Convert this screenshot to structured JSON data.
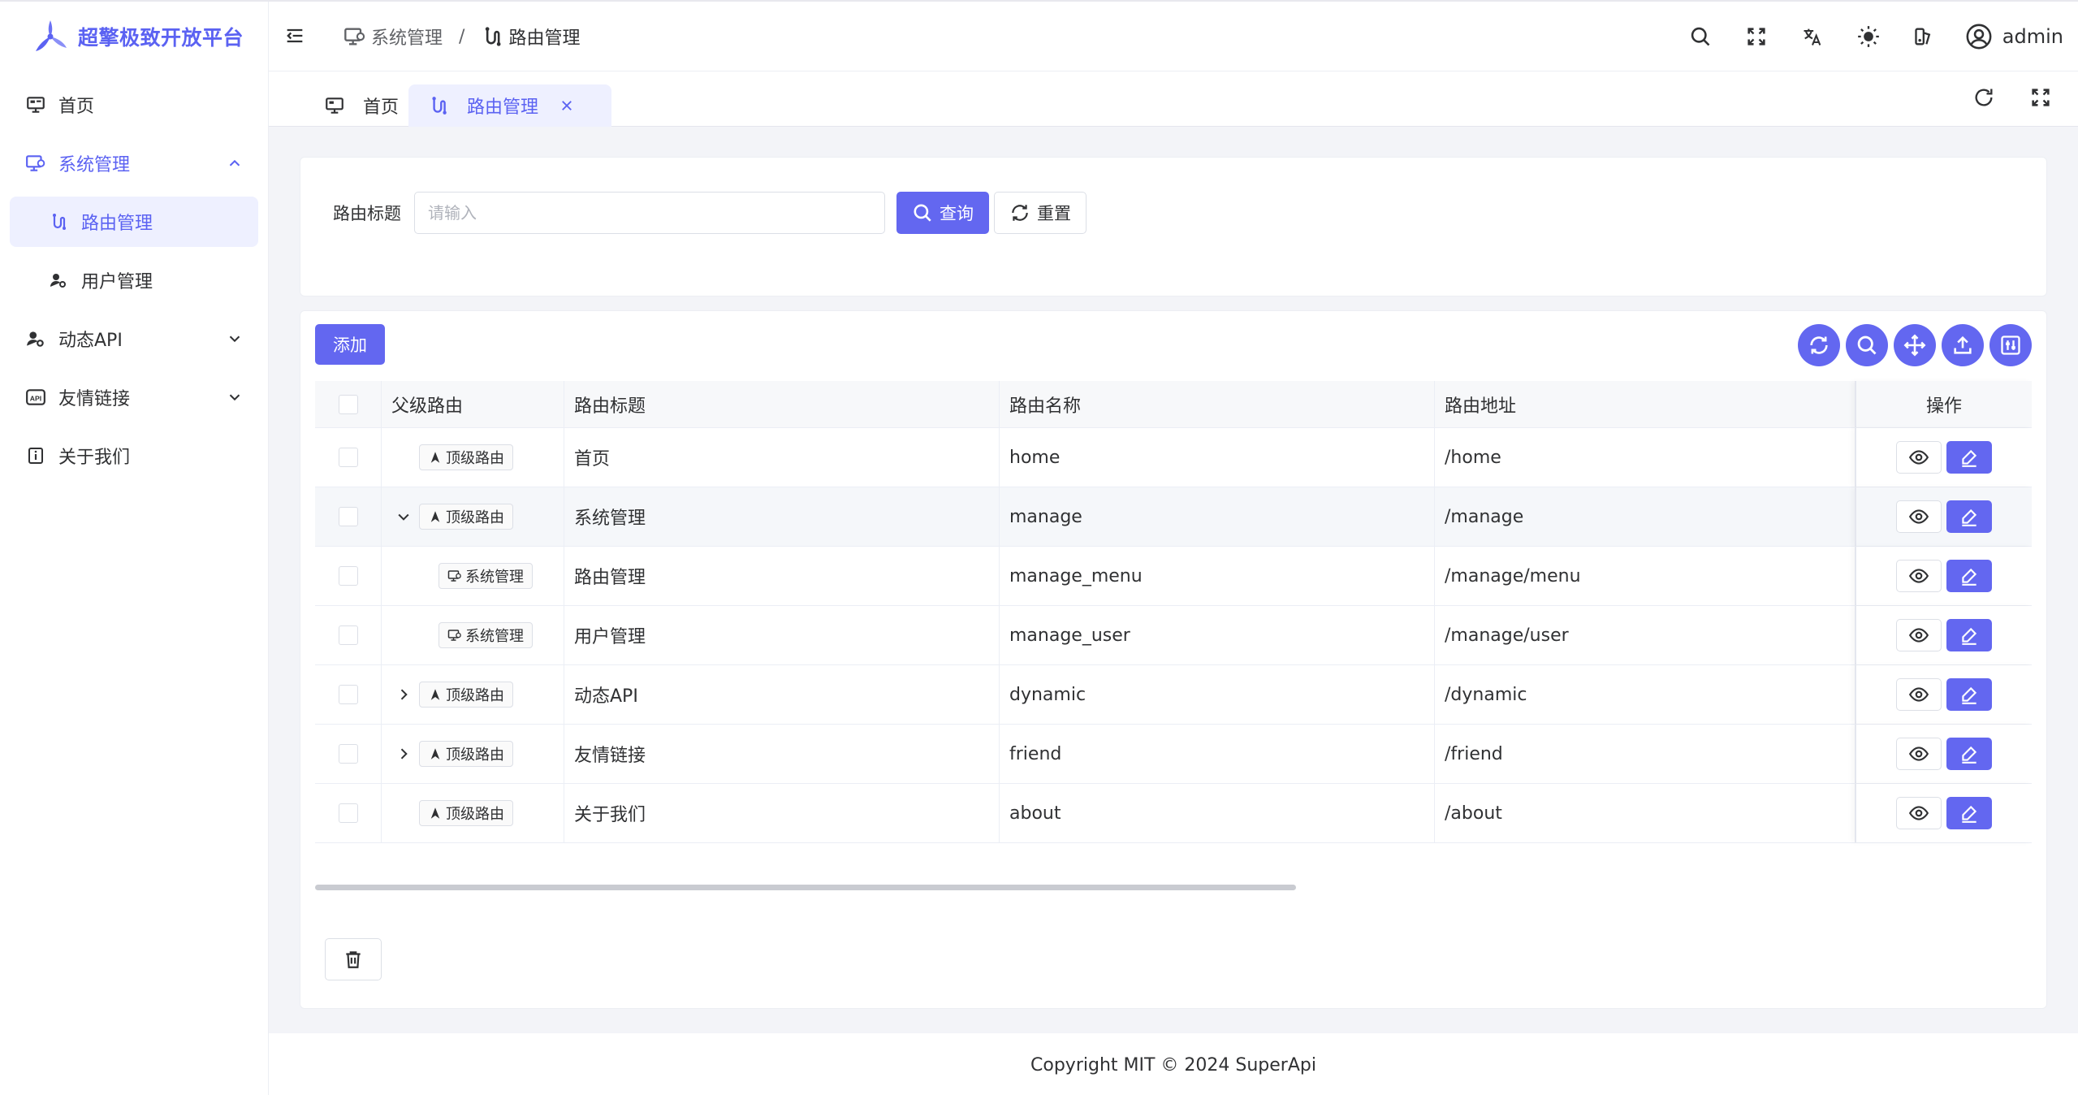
{
  "app": {
    "brand": "超擎极致开放平台",
    "accent": "#6367f0"
  },
  "sidebar": {
    "items": [
      {
        "label": "首页",
        "icon": "monitor-icon"
      },
      {
        "label": "系统管理",
        "icon": "system-monitor-icon",
        "open": true
      },
      {
        "label": "路由管理",
        "icon": "route-icon",
        "active": true
      },
      {
        "label": "用户管理",
        "icon": "user-gear-icon"
      },
      {
        "label": "动态API",
        "icon": "user-gear-icon"
      },
      {
        "label": "友情链接",
        "icon": "api-icon"
      },
      {
        "label": "关于我们",
        "icon": "info-icon"
      }
    ]
  },
  "header": {
    "breadcrumb": [
      "系统管理",
      "路由管理"
    ],
    "username": "admin"
  },
  "tabs": [
    "首页",
    "路由管理"
  ],
  "search": {
    "label": "路由标题",
    "placeholder": "请输入",
    "query_label": "查询",
    "reset_label": "重置"
  },
  "toolbar": {
    "add_label": "添加"
  },
  "table": {
    "headers": [
      "父级路由",
      "路由标题",
      "路由名称",
      "路由地址",
      "操作"
    ],
    "rows": [
      {
        "parent": "顶级路由",
        "title": "首页",
        "name": "home",
        "path": "/home"
      },
      {
        "parent": "顶级路由",
        "title": "系统管理",
        "name": "manage",
        "path": "/manage"
      },
      {
        "parent": "系统管理",
        "title": "路由管理",
        "name": "manage_menu",
        "path": "/manage/menu"
      },
      {
        "parent": "系统管理",
        "title": "用户管理",
        "name": "manage_user",
        "path": "/manage/user"
      },
      {
        "parent": "顶级路由",
        "title": "动态API",
        "name": "dynamic",
        "path": "/dynamic"
      },
      {
        "parent": "顶级路由",
        "title": "友情链接",
        "name": "friend",
        "path": "/friend"
      },
      {
        "parent": "顶级路由",
        "title": "关于我们",
        "name": "about",
        "path": "/about"
      }
    ]
  },
  "footer": {
    "copyright": "Copyright MIT © 2024 SuperApi"
  }
}
